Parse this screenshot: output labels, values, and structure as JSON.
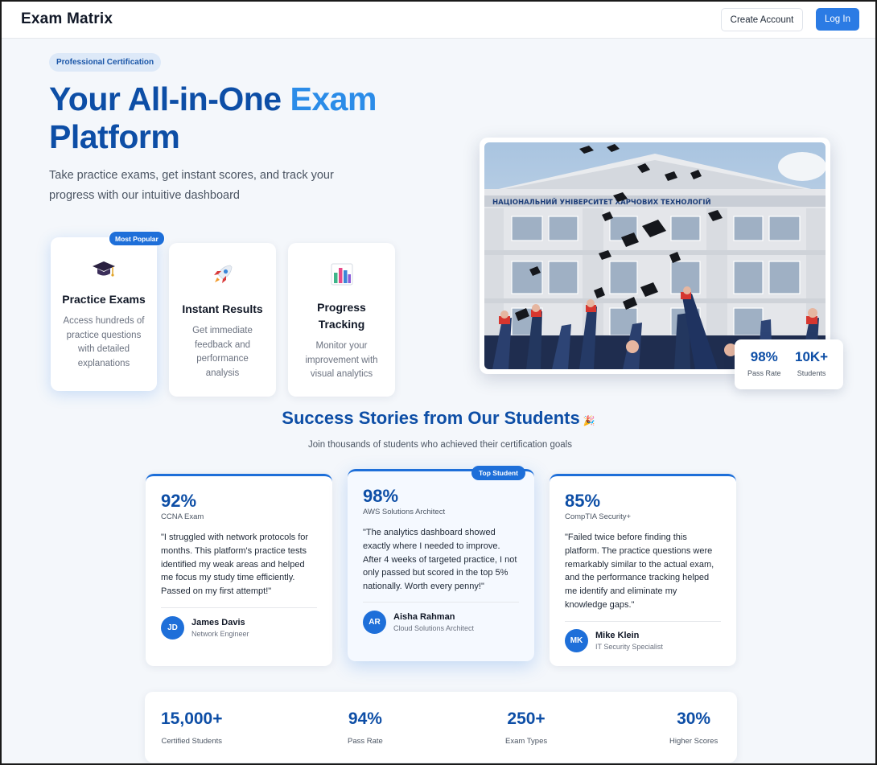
{
  "header": {
    "brand": "Exam Matrix",
    "create_account": "Create Account",
    "login": "Log In"
  },
  "hero": {
    "badge": "Professional Certification",
    "title_line1_part1": "Your All-in-One",
    "title_line1_part2": "Exam",
    "title_line2": "Platform",
    "subtitle": "Take practice exams, get instant scores, and track your progress with our intuitive dashboard"
  },
  "features": {
    "popular_badge": "Most Popular",
    "items": [
      {
        "icon": "graduation-cap-icon",
        "title": "Practice Exams",
        "desc": "Access hundreds of practice questions with detailed explanations"
      },
      {
        "icon": "rocket-icon",
        "title": "Instant Results",
        "desc": "Get immediate feedback and performance analysis"
      },
      {
        "icon": "bar-chart-icon",
        "title": "Progress Tracking",
        "desc": "Monitor your improvement with visual analytics"
      }
    ]
  },
  "hero_stats": [
    {
      "value": "98%",
      "label": "Pass Rate"
    },
    {
      "value": "10K+",
      "label": "Students"
    }
  ],
  "stories": {
    "title": "Success Stories from Our Students",
    "title_icon": "party-popper-icon",
    "subtitle": "Join thousands of students who achieved their certification goals",
    "top_badge": "Top Student",
    "items": [
      {
        "score": "92%",
        "exam": "CCNA Exam",
        "quote": "\"I struggled with network protocols for months. This platform's practice tests identified my weak areas and helped me focus my study time efficiently. Passed on my first attempt!\"",
        "initials": "JD",
        "name": "James Davis",
        "role": "Network Engineer"
      },
      {
        "score": "98%",
        "exam": "AWS Solutions Architect",
        "quote": "\"The analytics dashboard showed exactly where I needed to improve. After 4 weeks of targeted practice, I not only passed but scored in the top 5% nationally. Worth every penny!\"",
        "initials": "AR",
        "name": "Aisha Rahman",
        "role": "Cloud Solutions Architect"
      },
      {
        "score": "85%",
        "exam": "CompTIA Security+",
        "quote": "\"Failed twice before finding this platform. The practice questions were remarkably similar to the actual exam, and the performance tracking helped me identify and eliminate my knowledge gaps.\"",
        "initials": "MK",
        "name": "Mike Klein",
        "role": "IT Security Specialist"
      }
    ]
  },
  "bottom_stats": [
    {
      "value": "15,000+",
      "label": "Certified Students"
    },
    {
      "value": "94%",
      "label": "Pass Rate"
    },
    {
      "value": "250+",
      "label": "Exam Types"
    },
    {
      "value": "30%",
      "label": "Higher Scores"
    }
  ],
  "colors": {
    "brand_dark": "#0d4ea6",
    "accent": "#2b8ce8",
    "button": "#2b7be4",
    "badge": "#1e6fd9"
  }
}
